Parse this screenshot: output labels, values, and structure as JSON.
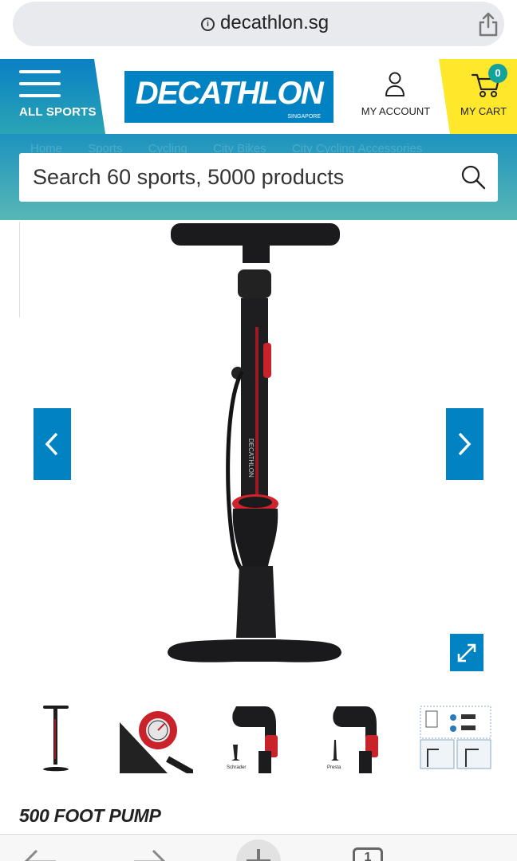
{
  "browser": {
    "url": "decathlon.sg",
    "icons": [
      "info-icon",
      "share-icon"
    ]
  },
  "header": {
    "menu_label": "ALL SPORTS",
    "logo_text": "DECATHLON",
    "logo_subtext": "SINGAPORE",
    "account_label": "MY ACCOUNT",
    "cart_label": "MY CART",
    "cart_count": "0",
    "colors": {
      "brand_blue": "#0082c3",
      "cart_yellow": "#ffe82b",
      "badge_teal": "#14a39a"
    }
  },
  "breadcrumb": [
    "Home",
    "Sports",
    "Cycling",
    "City Bikes",
    "City Cycling Accessories"
  ],
  "search": {
    "placeholder": "Search 60 sports, 5000 products"
  },
  "gallery": {
    "main_image": "foot-pump-image",
    "thumbnails": [
      {
        "name": "pump-full-thumb",
        "label": ""
      },
      {
        "name": "pressure-gauge-thumb",
        "label": ""
      },
      {
        "name": "schrader-head-thumb",
        "label": "Schrader"
      },
      {
        "name": "presta-head-thumb",
        "label": "Presta"
      },
      {
        "name": "instructions-diagram-thumb",
        "label": ""
      }
    ]
  },
  "product": {
    "title": "500 FOOT PUMP"
  },
  "toolbar": {
    "tab_count": "1",
    "icons": [
      "back-icon",
      "forward-icon",
      "new-tab-icon",
      "tabs-icon",
      "more-icon"
    ]
  }
}
